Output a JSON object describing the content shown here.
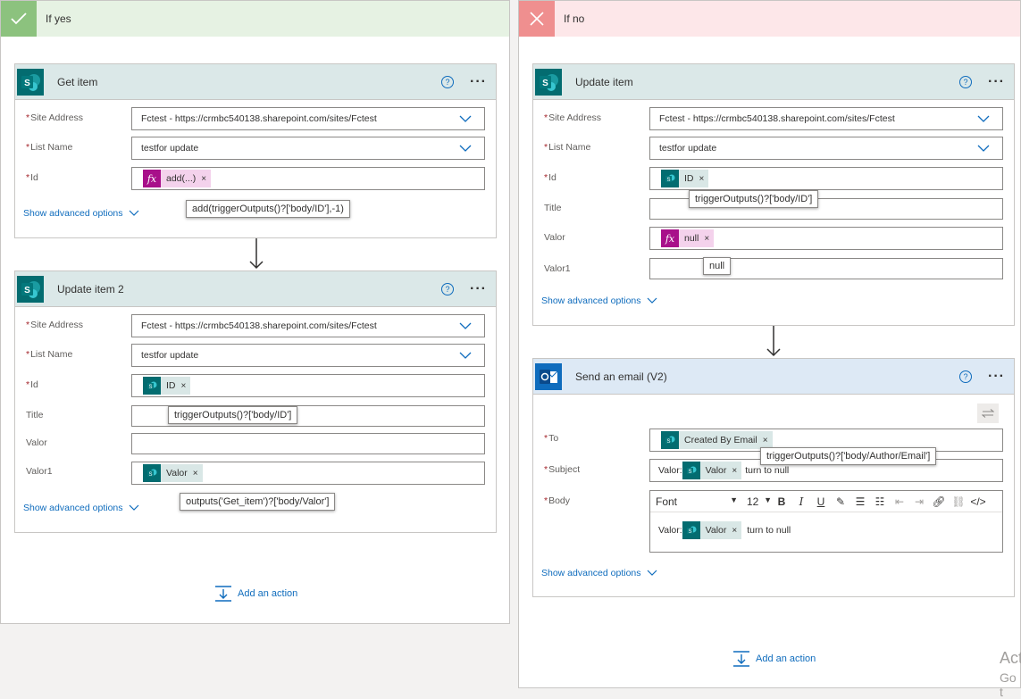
{
  "branch_yes": {
    "title": "If yes",
    "get_item": {
      "title": "Get item",
      "site_address_label": "Site Address",
      "site_address_value": "Fctest - https://crmbc540138.sharepoint.com/sites/Fctest",
      "list_name_label": "List Name",
      "list_name_value": "testfor update",
      "id_label": "Id",
      "id_token": "add(...)",
      "id_tooltip": "add(triggerOutputs()?['body/ID'],-1)",
      "advanced": "Show advanced options"
    },
    "update_item_2": {
      "title": "Update item 2",
      "site_address_label": "Site Address",
      "site_address_value": "Fctest - https://crmbc540138.sharepoint.com/sites/Fctest",
      "list_name_label": "List Name",
      "list_name_value": "testfor update",
      "id_label": "Id",
      "id_token": "ID",
      "id_tooltip": "triggerOutputs()?['body/ID']",
      "title_label": "Title",
      "valor_label": "Valor",
      "valor1_label": "Valor1",
      "valor1_token": "Valor",
      "valor1_tooltip": "outputs('Get_item')?['body/Valor']",
      "advanced": "Show advanced options"
    },
    "add_action": "Add an action"
  },
  "branch_no": {
    "title": "If no",
    "update_item": {
      "title": "Update item",
      "site_address_label": "Site Address",
      "site_address_value": "Fctest - https://crmbc540138.sharepoint.com/sites/Fctest",
      "list_name_label": "List Name",
      "list_name_value": "testfor update",
      "id_label": "Id",
      "id_token": "ID",
      "id_tooltip": "triggerOutputs()?['body/ID']",
      "title_label": "Title",
      "valor_label": "Valor",
      "valor_token": "null",
      "valor1_label": "Valor1",
      "valor1_tooltip": "null",
      "advanced": "Show advanced options"
    },
    "send_email": {
      "title": "Send an email (V2)",
      "to_label": "To",
      "to_token": "Created By Email",
      "to_tooltip": "triggerOutputs()?['body/Author/Email']",
      "subject_label": "Subject",
      "subject_prefix": "Valor:",
      "subject_token": "Valor",
      "subject_suffix": "turn to null",
      "body_label": "Body",
      "font_name": "Font",
      "font_size": "12",
      "body_prefix": "Valor:",
      "body_token": "Valor",
      "body_suffix": "turn to null",
      "advanced": "Show advanced options"
    },
    "add_action": "Add an action"
  },
  "watermark": {
    "line1": "Act",
    "line2": "Go t"
  },
  "colors": {
    "sharepoint": "#036c70",
    "outlook": "#0f6cbd",
    "expression": "#a8108a",
    "link": "#0f6cbd",
    "yes_bg": "#e6f2e3",
    "no_bg": "#fde7e9"
  },
  "icons": [
    "check-icon",
    "x-icon",
    "sharepoint-icon",
    "outlook-icon",
    "help-icon",
    "more-icon",
    "chevron-down-icon",
    "arrow-down-icon",
    "add-action-icon",
    "swap-icon"
  ]
}
